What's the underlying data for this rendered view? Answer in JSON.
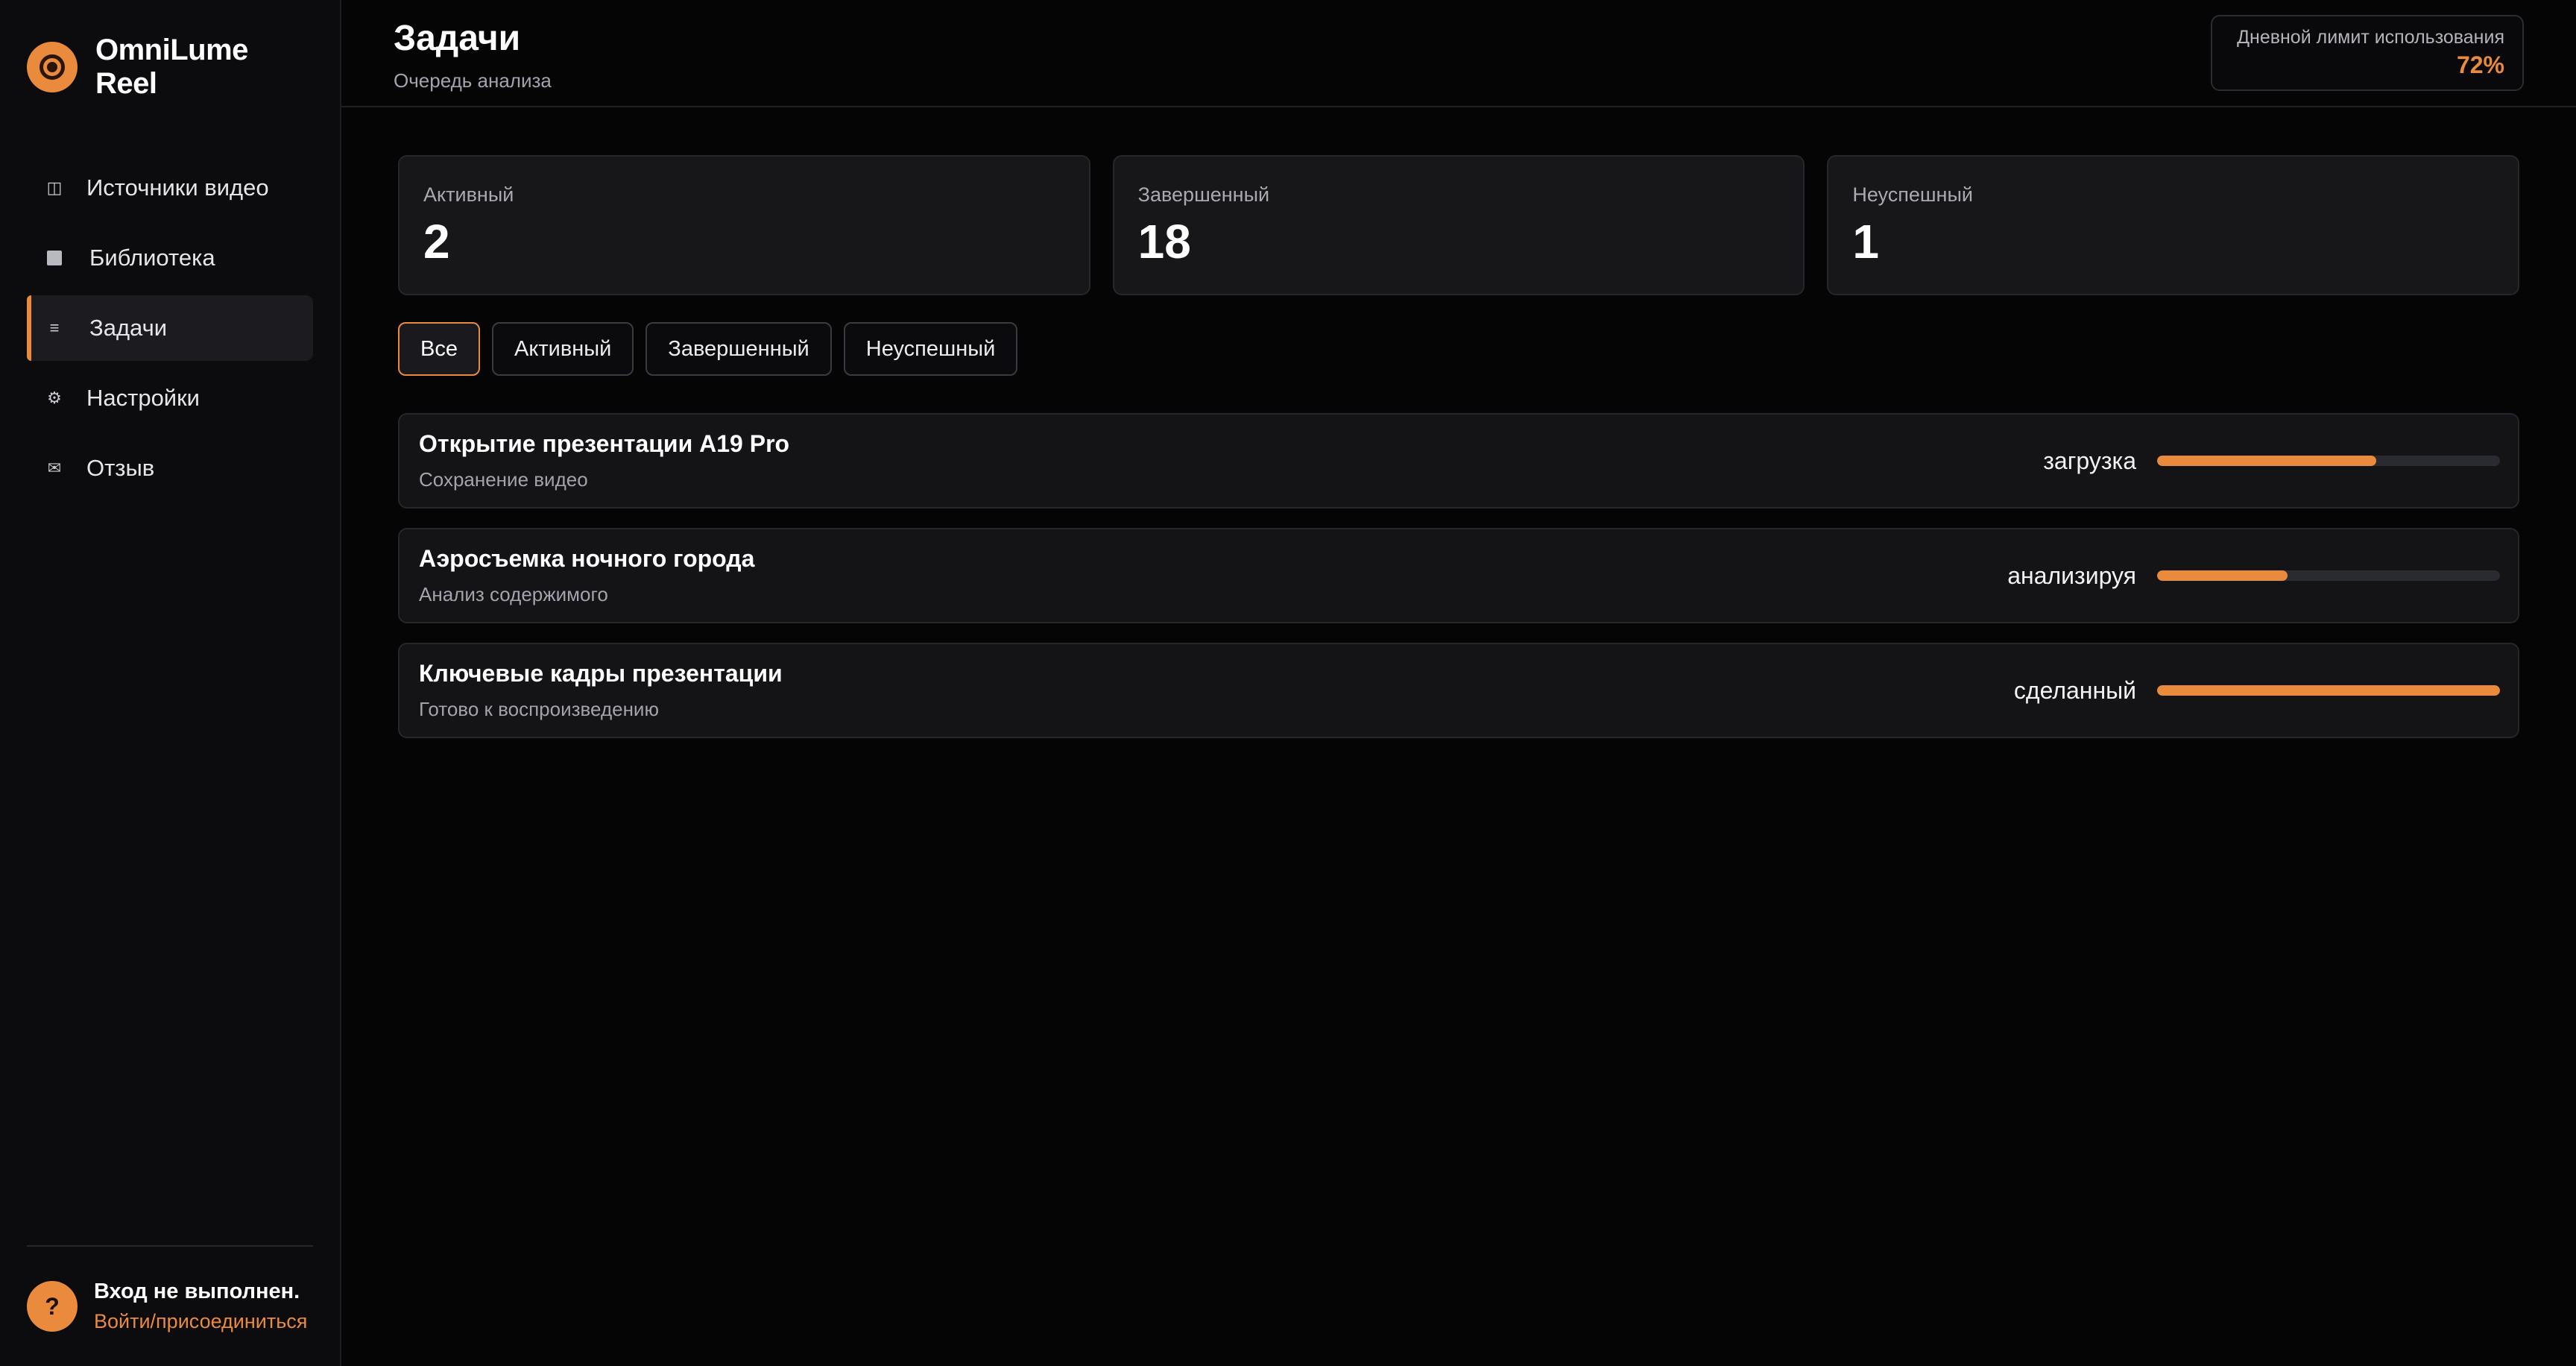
{
  "brand": {
    "name": "OmniLume Reel",
    "logo_icon": "lens-icon",
    "accent": "#e98a3c"
  },
  "sidebar": {
    "items": [
      {
        "label": "Источники видео",
        "icon": "columns-icon",
        "active": false
      },
      {
        "label": "Библиотека",
        "icon": "square-icon",
        "active": false
      },
      {
        "label": "Задачи",
        "icon": "list-icon",
        "active": true
      },
      {
        "label": "Настройки",
        "icon": "gear-icon",
        "active": false
      },
      {
        "label": "Отзыв",
        "icon": "envelope-icon",
        "active": false
      }
    ],
    "footer": {
      "badge": "?",
      "title": "Вход не выполнен.",
      "link": "Войти/присоединиться"
    }
  },
  "header": {
    "title": "Задачи",
    "subtitle": "Очередь анализа",
    "usage": {
      "label": "Дневной лимит использования",
      "value": "72%"
    }
  },
  "stats": [
    {
      "label": "Активный",
      "value": "2"
    },
    {
      "label": "Завершенный",
      "value": "18"
    },
    {
      "label": "Неуспешный",
      "value": "1"
    }
  ],
  "filters": [
    {
      "label": "Все",
      "active": true
    },
    {
      "label": "Активный",
      "active": false
    },
    {
      "label": "Завершенный",
      "active": false
    },
    {
      "label": "Неуспешный",
      "active": false
    }
  ],
  "tasks": [
    {
      "title": "Открытие презентации A19 Pro",
      "subtitle": "Сохранение видео",
      "status": "загрузка",
      "progress": 0.64
    },
    {
      "title": "Аэросъемка ночного города",
      "subtitle": "Анализ содержимого",
      "status": "анализируя",
      "progress": 0.38
    },
    {
      "title": "Ключевые кадры презентации",
      "subtitle": "Готово к воспроизведению",
      "status": "сделанный",
      "progress": 1.0
    }
  ]
}
